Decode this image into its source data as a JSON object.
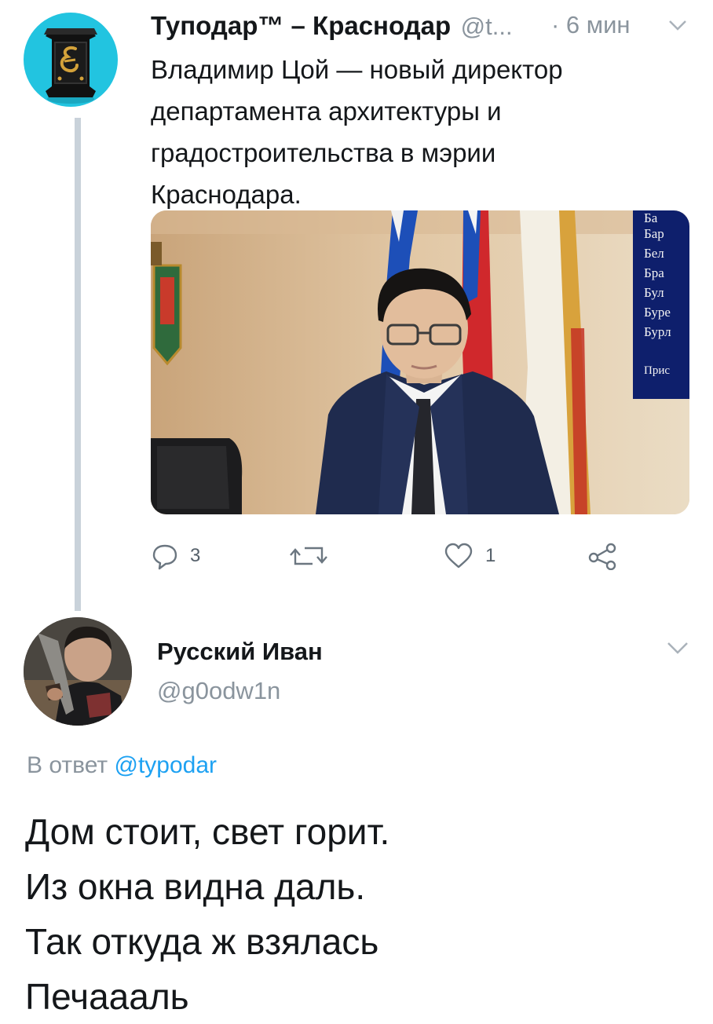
{
  "tweet": {
    "author_name": "Туподар™ – Краснодар",
    "handle": "@t...",
    "time": "· 6 мин",
    "text_lines": [
      "Владимир Цой — новый директор",
      "департамента архитектуры и",
      "градостроительства в мэрии",
      "Краснодара."
    ],
    "media_board_lines": [
      "Ба",
      "Бар",
      "Бел",
      "Бра",
      "Бул",
      "Буре",
      "Бурл",
      "Прис"
    ],
    "actions": {
      "reply_count": "3",
      "retweet_count": "",
      "like_count": "1"
    }
  },
  "reply": {
    "author_name": "Русский Иван",
    "handle": "@g0odw1n",
    "reply_prefix": "В ответ",
    "reply_mention": "@typodar",
    "text_lines": [
      "Дом стоит, свет горит.",
      "Из окна видна даль.",
      "Так откуда ж взялась",
      "Печаааль"
    ]
  },
  "colors": {
    "accent": "#1da1f2",
    "secondary_text": "#8a949d",
    "thread_line": "#c9d2da"
  },
  "icons": {
    "reply": "speech-bubble-icon",
    "retweet": "retweet-icon",
    "like": "heart-icon",
    "share": "share-icon",
    "menu": "chevron-down-icon"
  }
}
